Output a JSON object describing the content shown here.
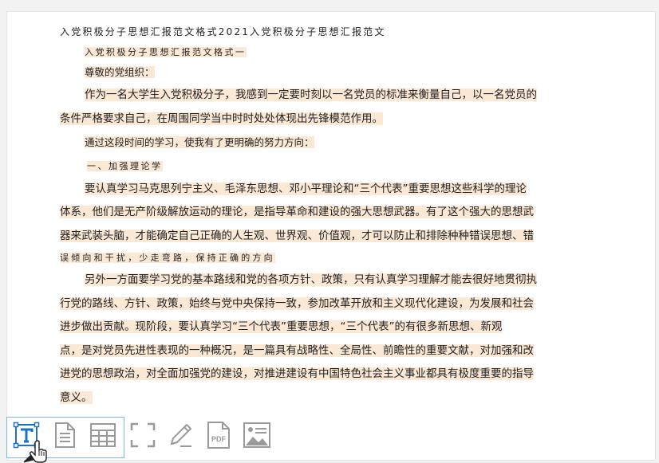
{
  "document": {
    "title": "入党积极分子思想汇报范文格式2021入党积极分子思想汇报范文",
    "subtitle": "入党积极分子思想汇报范文格式一",
    "salutation": "尊敬的党组织：",
    "p1": [
      "作为一名大学生入党积极分子，我感到一定要时刻以一名党员的标准来衡量自己，以一名党员的",
      "条件严格要求自己，在周围同学当中时时处处体现出先锋模范作用。"
    ],
    "p2": "通过这段时间的学习，使我有了更明确的努力方向：",
    "heading1": "一、加强理论学",
    "p3": [
      "要认真学习马克思列宁主义、毛泽东思想、邓小平理论和“三个代表”重要思想这些科学的理论",
      "体系，他们是无产阶级解放运动的理论，是指导革命和建设的强大思想武器。有了这个强大的思想武",
      "器来武装头脑，才能确定自己正确的人生观、世界观、价值观，才可以防止和排除种种错误思想、错",
      "误倾向和干扰，少走弯路，保持正确的方向"
    ],
    "p4": [
      "另外一方面要学习党的基本路线和党的各项方针、政策，只有认真学习理解才能去很好地贯彻执",
      "行党的路线、方针、政策，始终与党中央保持一致，参加改革开放和主义现代化建设，为发展和社会",
      "进步做出贡献。现阶段，要认真学习“三个代表”重要思想，“三个代表”的有很多新思想、新观",
      "点，是对党员先进性表现的一种概况，是一篇具有战略性、全局性、前瞻性的重要文献，对加强和改",
      "进党的思想政治，对全面加强党的建设，对推进建设有中国特色社会主义事业都具有极度重要的指导",
      "意义。"
    ]
  },
  "toolbar": {
    "tools": [
      {
        "name": "text-extract",
        "icon": "text-T-icon"
      },
      {
        "name": "document",
        "icon": "document-icon"
      },
      {
        "name": "table",
        "icon": "table-icon"
      },
      {
        "name": "crop",
        "icon": "fullscreen-crop-icon"
      },
      {
        "name": "edit",
        "icon": "pencil-icon"
      },
      {
        "name": "pdf",
        "icon": "pdf-icon",
        "label": "PDF"
      },
      {
        "name": "image",
        "icon": "image-icon"
      }
    ]
  },
  "colors": {
    "highlight": "#fbe9d6",
    "active_tool": "#1a73c8",
    "tool_gray": "#9a9a9a"
  }
}
